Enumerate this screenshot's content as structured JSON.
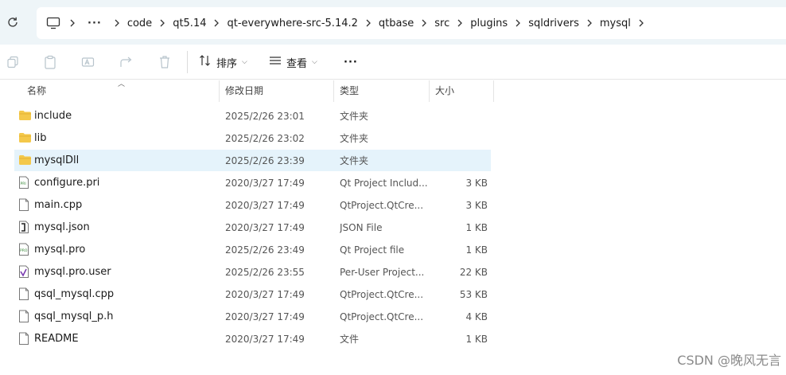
{
  "breadcrumbs": [
    "code",
    "qt5.14",
    "qt-everywhere-src-5.14.2",
    "qtbase",
    "src",
    "plugins",
    "sqldrivers",
    "mysql"
  ],
  "more_crumbs": "···",
  "toolbar": {
    "sort_label": "排序",
    "view_label": "查看",
    "more_label": "···"
  },
  "columns": {
    "name": "名称",
    "date": "修改日期",
    "type": "类型",
    "size": "大小"
  },
  "files": [
    {
      "name": "include",
      "date": "2025/2/26 23:01",
      "type": "文件夹",
      "size": "",
      "icon": "folder-icon"
    },
    {
      "name": "lib",
      "date": "2025/2/26 23:02",
      "type": "文件夹",
      "size": "",
      "icon": "folder-icon"
    },
    {
      "name": "mysqlDll",
      "date": "2025/2/26 23:39",
      "type": "文件夹",
      "size": "",
      "icon": "folder-icon"
    },
    {
      "name": "configure.pri",
      "date": "2020/3/27 17:49",
      "type": "Qt Project Includ...",
      "size": "3 KB",
      "icon": "pri-file-icon"
    },
    {
      "name": "main.cpp",
      "date": "2020/3/27 17:49",
      "type": "QtProject.QtCre...",
      "size": "3 KB",
      "icon": "file-icon"
    },
    {
      "name": "mysql.json",
      "date": "2020/3/27 17:49",
      "type": "JSON File",
      "size": "1 KB",
      "icon": "json-file-icon"
    },
    {
      "name": "mysql.pro",
      "date": "2025/2/26 23:49",
      "type": "Qt Project file",
      "size": "1 KB",
      "icon": "pro-file-icon"
    },
    {
      "name": "mysql.pro.user",
      "date": "2025/2/26 23:55",
      "type": "Per-User Project...",
      "size": "22 KB",
      "icon": "user-file-icon"
    },
    {
      "name": "qsql_mysql.cpp",
      "date": "2020/3/27 17:49",
      "type": "QtProject.QtCre...",
      "size": "53 KB",
      "icon": "file-icon"
    },
    {
      "name": "qsql_mysql_p.h",
      "date": "2020/3/27 17:49",
      "type": "QtProject.QtCre...",
      "size": "4 KB",
      "icon": "file-icon"
    },
    {
      "name": "README",
      "date": "2020/3/27 17:49",
      "type": "文件",
      "size": "1 KB",
      "icon": "file-icon"
    }
  ],
  "selected_index": 2,
  "watermark": "CSDN @晚风无言",
  "colors": {
    "address_bg": "#eef5f8",
    "selected_row": "#e5f3fb",
    "folder": "#f4c84a"
  }
}
